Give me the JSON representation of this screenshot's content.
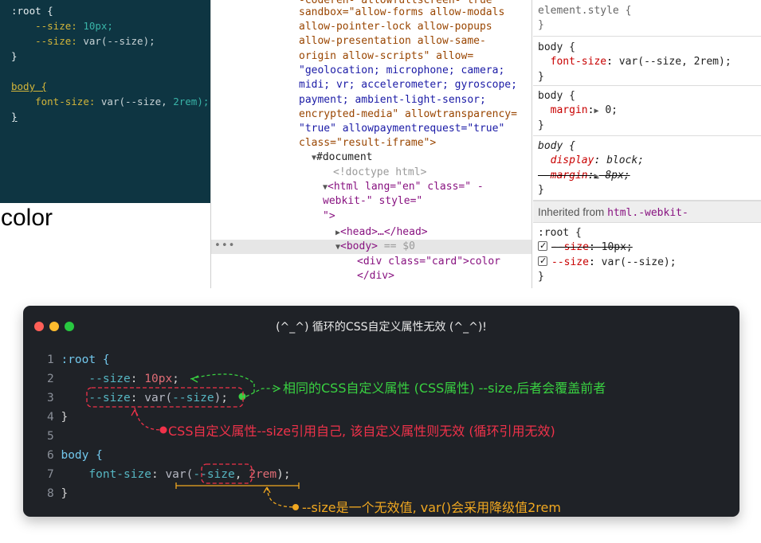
{
  "editor": {
    "lines": [
      ":root {",
      "--size:",
      "10px;",
      "--size:",
      "var(--size);",
      "}",
      "body {",
      "font-size:",
      "var(--size,",
      "2rem);",
      "}"
    ]
  },
  "result": {
    "text": "color"
  },
  "elements": {
    "iframe_attrs": [
      "sandbox=\"allow-forms allow-modals",
      "allow-pointer-lock allow-popups",
      "allow-presentation allow-same-",
      "origin allow-scripts\" allow=",
      "\"geolocation; microphone; camera;",
      "midi; vr; accelerometer; gyroscope;",
      "payment; ambient-light-sensor;",
      "encrypted-media\" allowtransparency=",
      "\"true\" allowpaymentrequest=\"true\"",
      "class=\"result-iframe\">"
    ],
    "top_cut": "-coderen- allowfullscreen- true",
    "document": "#document",
    "doctype": "<!doctype html>",
    "html_open_1": "<html lang=\"en\" class=\" -",
    "html_open_2": "webkit-\" style=\"",
    "html_open_3": "\">",
    "head": "<head>…</head>",
    "body": "<body>",
    "body_marker": "== $0",
    "div_open": "<div class=\"card\">color",
    "div_close": "</div>",
    "dots": "•••"
  },
  "styles": {
    "element_style": "element.style {",
    "close": "}",
    "body1_sel": "body {",
    "body1_prop": "font-size",
    "body1_val": "var(--size, 2rem);",
    "body2_sel": "body {",
    "body2_prop": "margin",
    "body2_val": "0;",
    "body3_sel": "body {",
    "body3_prop1": "display",
    "body3_val1": "block;",
    "body3_prop2": "margin",
    "body3_val2": "8px;",
    "inherited_label": "Inherited from",
    "inherited_tag": "html.-webkit-",
    "root_sel": ":root {",
    "root_prop1": "--size",
    "root_val1": "10px;",
    "root_prop2": "--size",
    "root_val2": "var(--size);"
  },
  "card": {
    "title": "(^_^) 循环的CSS自定义属性无效 (^_^)!",
    "line_numbers": [
      "1",
      "2",
      "3",
      "4",
      "5",
      "6",
      "7",
      "8"
    ],
    "code": {
      "l1": ":root {",
      "l2_prop": "--size",
      "l2_val": "10px",
      "l3_prop": "--size",
      "l3_fn": "var(",
      "l3_arg": "--size",
      "l3_end": ")",
      "l4": "}",
      "l6": "body {",
      "l7_prop": "font-size",
      "l7_fn": "var(",
      "l7_arg": "--size",
      "l7_fallback": "2rem",
      "l7_end": ");",
      "l8": "}"
    },
    "annotations": {
      "green": "相同的CSS自定义属性 (CSS属性) --size,后者会覆盖前者",
      "red": "CSS自定义属性--size引用自己, 该自定义属性则无效 (循环引用无效)",
      "orange": "--size是一个无效值, var()会采用降级值2rem"
    },
    "colors": {
      "dot_red": "#fe5f57",
      "dot_yellow": "#febc2e",
      "dot_green": "#28c840",
      "green": "#39d141",
      "red": "#f0324a",
      "orange": "#f1a820"
    }
  }
}
